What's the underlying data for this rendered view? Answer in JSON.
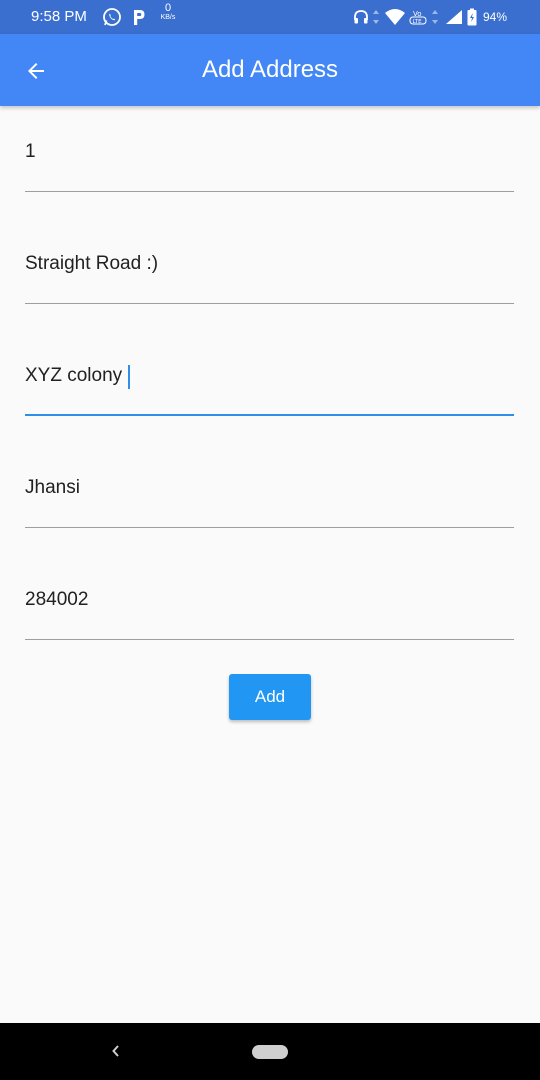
{
  "status_bar": {
    "time": "9:58 PM",
    "network_speed_value": "0",
    "network_speed_unit": "KB/s",
    "battery_percent": "94%",
    "icons": [
      "whatsapp-icon",
      "p-icon",
      "headphones-icon",
      "wifi-icon",
      "volte-icon",
      "signal-icon",
      "battery-icon"
    ]
  },
  "app_bar": {
    "title": "Add Address",
    "back_icon": "arrow-left-icon",
    "color": "#4287f5"
  },
  "form": {
    "fields": [
      {
        "value": "1"
      },
      {
        "value": "Straight Road :)"
      },
      {
        "value": "XYZ colony",
        "focused": true
      },
      {
        "value": "Jhansi"
      },
      {
        "value": "284002"
      }
    ],
    "submit_label": "Add",
    "accent_color": "#2196f3"
  },
  "nav_bar": {
    "back_icon": "chevron-left-icon",
    "home_icon": "home-pill-icon"
  }
}
